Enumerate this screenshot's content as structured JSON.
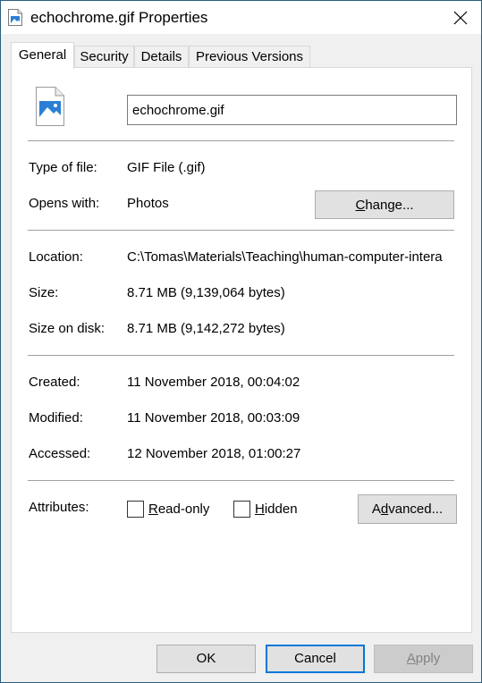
{
  "window": {
    "title": "echochrome.gif Properties",
    "close_icon": "close-icon",
    "app_icon": "image-file-icon"
  },
  "tabs": [
    {
      "label": "General",
      "active": true
    },
    {
      "label": "Security",
      "active": false
    },
    {
      "label": "Details",
      "active": false
    },
    {
      "label": "Previous Versions",
      "active": false
    }
  ],
  "general": {
    "file_name": "echochrome.gif",
    "file_icon": "image-file-icon",
    "type_label": "Type of file:",
    "type_value": "GIF File (.gif)",
    "opens_label": "Opens with:",
    "opens_value": "Photos",
    "change_button_prefix": "",
    "change_button_mnemonic": "C",
    "change_button_suffix": "hange...",
    "location_label": "Location:",
    "location_value": "C:\\Tomas\\Materials\\Teaching\\human-computer-intera",
    "size_label": "Size:",
    "size_value": "8.71 MB (9,139,064 bytes)",
    "size_disk_label": "Size on disk:",
    "size_disk_value": "8.71 MB (9,142,272 bytes)",
    "created_label": "Created:",
    "created_value": "11 November 2018, 00:04:02",
    "modified_label": "Modified:",
    "modified_value": "11 November 2018, 00:03:09",
    "accessed_label": "Accessed:",
    "accessed_value": "12 November 2018, 01:00:27",
    "attributes_label": "Attributes:",
    "readonly_mnemonic": "R",
    "readonly_rest": "ead-only",
    "readonly_checked": false,
    "hidden_mnemonic": "H",
    "hidden_rest": "idden",
    "hidden_checked": false,
    "advanced_prefix": "A",
    "advanced_mnemonic": "d",
    "advanced_suffix": "vanced..."
  },
  "footer": {
    "ok_label": "OK",
    "cancel_label": "Cancel",
    "apply_mnemonic": "A",
    "apply_rest": "pply"
  }
}
